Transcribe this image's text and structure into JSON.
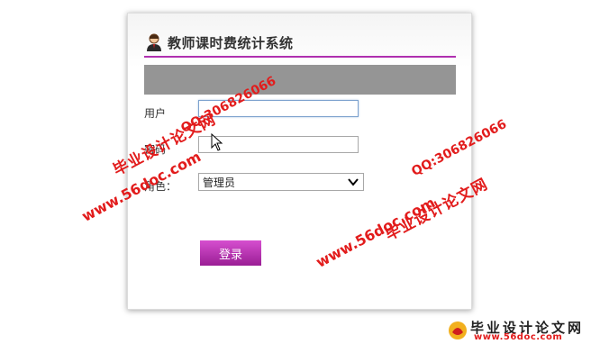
{
  "header": {
    "title": "教师课时费统计系统"
  },
  "form": {
    "username_label": "用户",
    "password_label": "密码",
    "role_label": "角色：",
    "role_value": "管理员",
    "login_label": "登录"
  },
  "watermarks": {
    "cn_name": "毕业设计论文网",
    "url": "www.56doc.com",
    "qq": "QQ:306826066"
  },
  "footer": {
    "cn_name": "毕业设计论文网",
    "url": "www.56doc.com"
  },
  "colors": {
    "accent": "#b030b0",
    "login_button": "#c040c0",
    "watermark": "#e21c1c",
    "gray_bar": "#959595"
  }
}
